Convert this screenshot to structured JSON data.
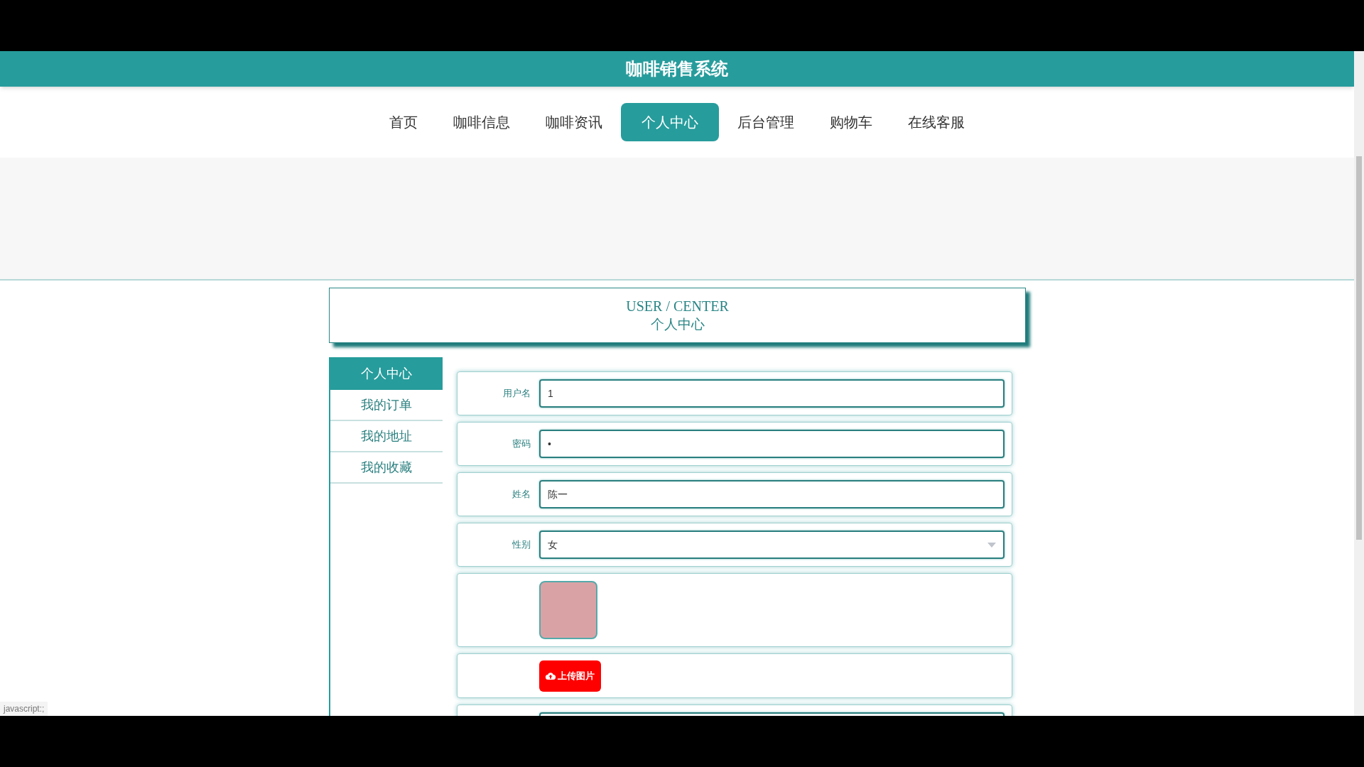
{
  "header": {
    "title": "咖啡销售系统"
  },
  "nav": [
    {
      "label": "首页",
      "selected": false
    },
    {
      "label": "咖啡信息",
      "selected": false
    },
    {
      "label": "咖啡资讯",
      "selected": false
    },
    {
      "label": "个人中心",
      "selected": true
    },
    {
      "label": "后台管理",
      "selected": false
    },
    {
      "label": "购物车",
      "selected": false
    },
    {
      "label": "在线客服",
      "selected": false
    }
  ],
  "section_title": {
    "english": "USER / CENTER",
    "chinese": "个人中心"
  },
  "sidebar": [
    {
      "label": "个人中心",
      "selected": true
    },
    {
      "label": "我的订单",
      "selected": false
    },
    {
      "label": "我的地址",
      "selected": false
    },
    {
      "label": "我的收藏",
      "selected": false
    }
  ],
  "form": [
    {
      "kind": "text",
      "label": "用户名",
      "value": "1"
    },
    {
      "kind": "password",
      "label": "密码",
      "value": "•"
    },
    {
      "kind": "text",
      "label": "姓名",
      "value": "陈一"
    },
    {
      "kind": "select",
      "label": "性别",
      "value": "女"
    },
    {
      "kind": "photo"
    },
    {
      "kind": "upload",
      "button": "上传图片"
    },
    {
      "kind": "text"
    }
  ],
  "status_bar": "javascript:;"
}
